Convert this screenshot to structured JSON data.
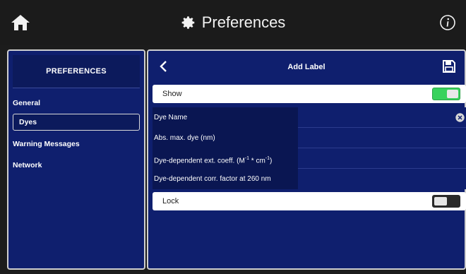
{
  "header": {
    "title": "Preferences",
    "icons": {
      "home": "home-icon",
      "settings": "gear-icon",
      "info": "info-icon"
    }
  },
  "sidebar": {
    "heading": "PREFERENCES",
    "items": [
      {
        "label": "General",
        "active": false
      },
      {
        "label": "Dyes",
        "active": true
      },
      {
        "label": "Warning Messages",
        "active": false
      },
      {
        "label": "Network",
        "active": false
      }
    ]
  },
  "main": {
    "title": "Add Label",
    "icons": {
      "back": "chevron-left-icon",
      "save": "save-icon",
      "clear": "clear-icon"
    },
    "show": {
      "label": "Show",
      "on": true
    },
    "fields": [
      {
        "label": "Dye Name",
        "value": ""
      },
      {
        "label": "Abs. max. dye (nm)",
        "value": ""
      },
      {
        "label_pre": "Dye-dependent ext. coeff. (M",
        "label_sup1": "-1",
        "label_mid": " * cm",
        "label_sup2": "-1",
        "label_post": ")",
        "value": ""
      },
      {
        "label": "Dye-dependent corr. factor at 260 nm",
        "value": ""
      }
    ],
    "lock": {
      "label": "Lock",
      "on": false
    }
  },
  "colors": {
    "panel": "#0f1f6e",
    "label_bg": "#0a1652",
    "toggle_on": "#38d25c",
    "toggle_off": "#2a2a2a",
    "topbar": "#1b1b1b"
  }
}
